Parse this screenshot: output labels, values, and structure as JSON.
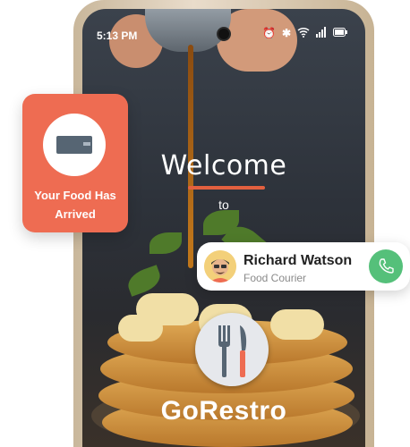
{
  "status_bar": {
    "time": "5:13 PM",
    "icons": [
      "alarm-icon",
      "bluetooth-icon",
      "wifi-icon",
      "signal-icon",
      "battery-icon"
    ]
  },
  "splash": {
    "welcome": "Welcome",
    "to": "to",
    "brand": "GoRestro"
  },
  "notification_card": {
    "text": "Your Food Has Arrived",
    "icon": "food-box-icon"
  },
  "courier_card": {
    "name": "Richard Watson",
    "role": "Food Courier",
    "icon": "phone-icon"
  },
  "colors": {
    "accent": "#ee6c52",
    "call_green": "#55c07a"
  }
}
